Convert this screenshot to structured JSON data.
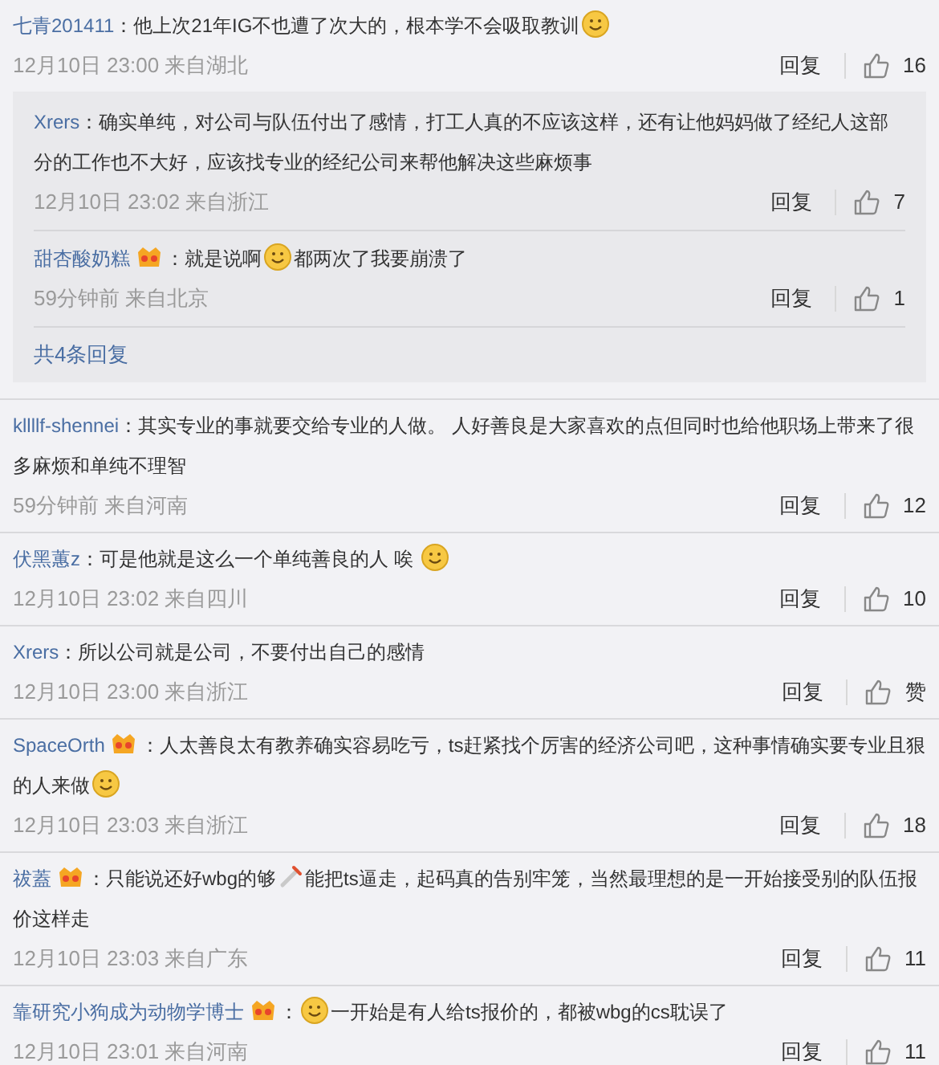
{
  "sep": "：",
  "comments": [
    {
      "user": "七青201411",
      "badge": false,
      "parts": [
        {
          "kind": "text",
          "text": "他上次21年IG不也遭了次大的，根本学不会吸取教训"
        },
        {
          "kind": "emoji"
        }
      ],
      "meta": "12月10日 23:00 来自湖北",
      "reply": "回复",
      "likes": "16",
      "replies": {
        "items": [
          {
            "user": "Xrers",
            "badge": false,
            "parts": [
              {
                "kind": "text",
                "text": "确实单纯，对公司与队伍付出了感情，打工人真的不应该这样，还有让他妈妈做了经纪人这部分的工作也不大好，应该找专业的经纪公司来帮他解决这些麻烦事"
              }
            ],
            "meta": "12月10日 23:02 来自浙江",
            "reply": "回复",
            "likes": "7"
          },
          {
            "user": "甜杏酸奶糕",
            "badge": true,
            "parts": [
              {
                "kind": "text",
                "text": "就是说啊"
              },
              {
                "kind": "emoji"
              },
              {
                "kind": "text",
                "text": "都两次了我要崩溃了"
              }
            ],
            "meta": "59分钟前 来自北京",
            "reply": "回复",
            "likes": "1"
          }
        ],
        "more": "共4条回复"
      }
    },
    {
      "user": "kllllf-shennei",
      "badge": false,
      "parts": [
        {
          "kind": "text",
          "text": "其实专业的事就要交给专业的人做。 人好善良是大家喜欢的点但同时也给他职场上带来了很多麻烦和单纯不理智"
        }
      ],
      "meta": "59分钟前 来自河南",
      "reply": "回复",
      "likes": "12"
    },
    {
      "user": "伏黑蕙z",
      "badge": false,
      "parts": [
        {
          "kind": "text",
          "text": "可是他就是这么一个单纯善良的人 唉 "
        },
        {
          "kind": "emoji"
        }
      ],
      "meta": "12月10日 23:02 来自四川",
      "reply": "回复",
      "likes": "10"
    },
    {
      "user": "Xrers",
      "badge": false,
      "parts": [
        {
          "kind": "text",
          "text": "所以公司就是公司，不要付出自己的感情"
        }
      ],
      "meta": "12月10日 23:00 来自浙江",
      "reply": "回复",
      "likes": "赞"
    },
    {
      "user": "SpaceOrth",
      "badge": true,
      "parts": [
        {
          "kind": "text",
          "text": "人太善良太有教养确实容易吃亏，ts赶紧找个厉害的经济公司吧，这种事情确实要专业且狠的人来做"
        },
        {
          "kind": "emoji"
        }
      ],
      "meta": "12月10日 23:03 来自浙江",
      "reply": "回复",
      "likes": "18"
    },
    {
      "user": "祓蓋",
      "badge": true,
      "parts": [
        {
          "kind": "text",
          "text": "只能说还好wbg的够"
        },
        {
          "kind": "dagger"
        },
        {
          "kind": "text",
          "text": "能把ts逼走，起码真的告别牢笼，当然最理想的是一开始接受别的队伍报价这样走"
        }
      ],
      "meta": "12月10日 23:03 来自广东",
      "reply": "回复",
      "likes": "11"
    },
    {
      "user": "靠研究小狗成为动物学博士",
      "badge": true,
      "parts": [
        {
          "kind": "emoji"
        },
        {
          "kind": "text",
          "text": "一开始是有人给ts报价的，都被wbg的cs耽误了"
        }
      ],
      "meta": "12月10日 23:01 来自河南",
      "reply": "回复",
      "likes": "11"
    }
  ]
}
